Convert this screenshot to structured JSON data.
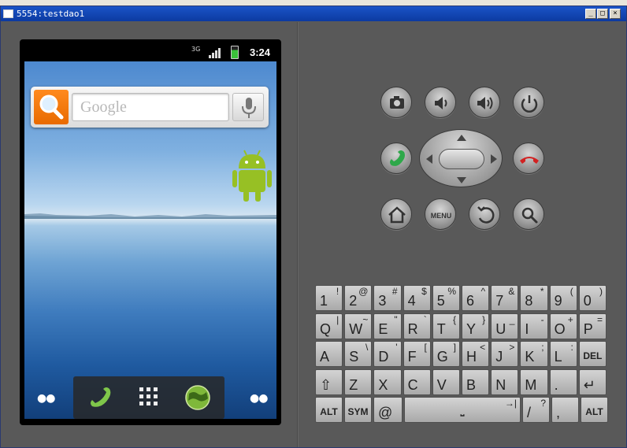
{
  "window": {
    "title": "5554:testdao1",
    "min": "_",
    "max": "□",
    "close": "×"
  },
  "status_bar": {
    "time": "3:24",
    "network": "3G"
  },
  "search": {
    "placeholder": "Google"
  },
  "hardware_buttons": [
    {
      "name": "camera-button",
      "icon": "camera-icon"
    },
    {
      "name": "volume-down-button",
      "icon": "volume-down-icon"
    },
    {
      "name": "volume-up-button",
      "icon": "volume-up-icon"
    },
    {
      "name": "power-button",
      "icon": "power-icon"
    },
    {
      "name": "call-button",
      "icon": "call-icon",
      "color": "#2ea84a"
    },
    {
      "name": "end-call-button",
      "icon": "end-call-icon",
      "color": "#d22222"
    },
    {
      "name": "home-button",
      "icon": "home-icon"
    },
    {
      "name": "menu-button",
      "label": "MENU"
    },
    {
      "name": "back-button",
      "icon": "back-icon"
    },
    {
      "name": "search-button",
      "icon": "search-icon"
    }
  ],
  "keyboard": {
    "row1": [
      {
        "main": "1",
        "alt": "!"
      },
      {
        "main": "2",
        "alt": "@"
      },
      {
        "main": "3",
        "alt": "#"
      },
      {
        "main": "4",
        "alt": "$"
      },
      {
        "main": "5",
        "alt": "%"
      },
      {
        "main": "6",
        "alt": "^"
      },
      {
        "main": "7",
        "alt": "&"
      },
      {
        "main": "8",
        "alt": "*"
      },
      {
        "main": "9",
        "alt": "("
      },
      {
        "main": "0",
        "alt": ")"
      }
    ],
    "row2": [
      {
        "main": "Q",
        "alt": "|"
      },
      {
        "main": "W",
        "alt": "~"
      },
      {
        "main": "E",
        "alt": "\""
      },
      {
        "main": "R",
        "alt": "`"
      },
      {
        "main": "T",
        "alt": "{"
      },
      {
        "main": "Y",
        "alt": "}"
      },
      {
        "main": "U",
        "alt": "_"
      },
      {
        "main": "I",
        "alt": "-"
      },
      {
        "main": "O",
        "alt": "+"
      },
      {
        "main": "P",
        "alt": "="
      }
    ],
    "row3": [
      {
        "main": "A",
        "alt": ""
      },
      {
        "main": "S",
        "alt": "\\"
      },
      {
        "main": "D",
        "alt": "'"
      },
      {
        "main": "F",
        "alt": "["
      },
      {
        "main": "G",
        "alt": "]"
      },
      {
        "main": "H",
        "alt": "<"
      },
      {
        "main": "J",
        "alt": ">"
      },
      {
        "main": "K",
        "alt": ";"
      },
      {
        "main": "L",
        "alt": ":"
      },
      {
        "main": "DEL",
        "alt": ""
      }
    ],
    "row4": [
      {
        "main": "⇧",
        "alt": ""
      },
      {
        "main": "Z",
        "alt": ""
      },
      {
        "main": "X",
        "alt": ""
      },
      {
        "main": "C",
        "alt": ""
      },
      {
        "main": "V",
        "alt": ""
      },
      {
        "main": "B",
        "alt": ""
      },
      {
        "main": "N",
        "alt": ""
      },
      {
        "main": "M",
        "alt": ""
      },
      {
        "main": ".",
        "alt": ""
      },
      {
        "main": "↵",
        "alt": ""
      }
    ],
    "row5": {
      "alt_left": "ALT",
      "sym": "SYM",
      "at": "@",
      "space": "⎵",
      "tab": "→|",
      "slash": "/",
      "question": "?",
      "comma": ",",
      "alt_right": "ALT"
    }
  }
}
